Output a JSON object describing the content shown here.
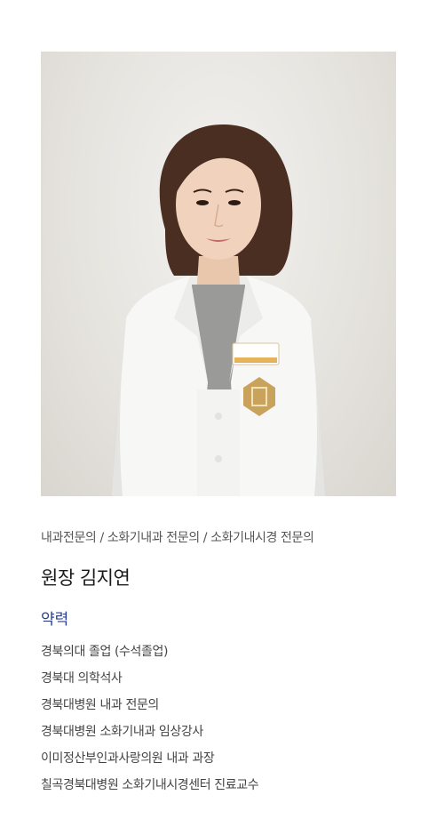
{
  "profile": {
    "specialty": "내과전문의 / 소화기내과 전문의 / 소화기내시경 전문의",
    "name": "원장 김지연",
    "career_heading": "약력",
    "career": [
      "경북의대 졸업 (수석졸업)",
      "경북대 의학석사",
      "경북대병원 내과 전문의",
      "경북대병원 소화기내과 임상강사",
      "이미정산부인과사랑의원 내과 과장",
      "칠곡경북대병원 소화기내시경센터 진료교수"
    ]
  },
  "colors": {
    "accent": "#2b3f8f",
    "text": "#444444",
    "name": "#1a1a1a"
  }
}
